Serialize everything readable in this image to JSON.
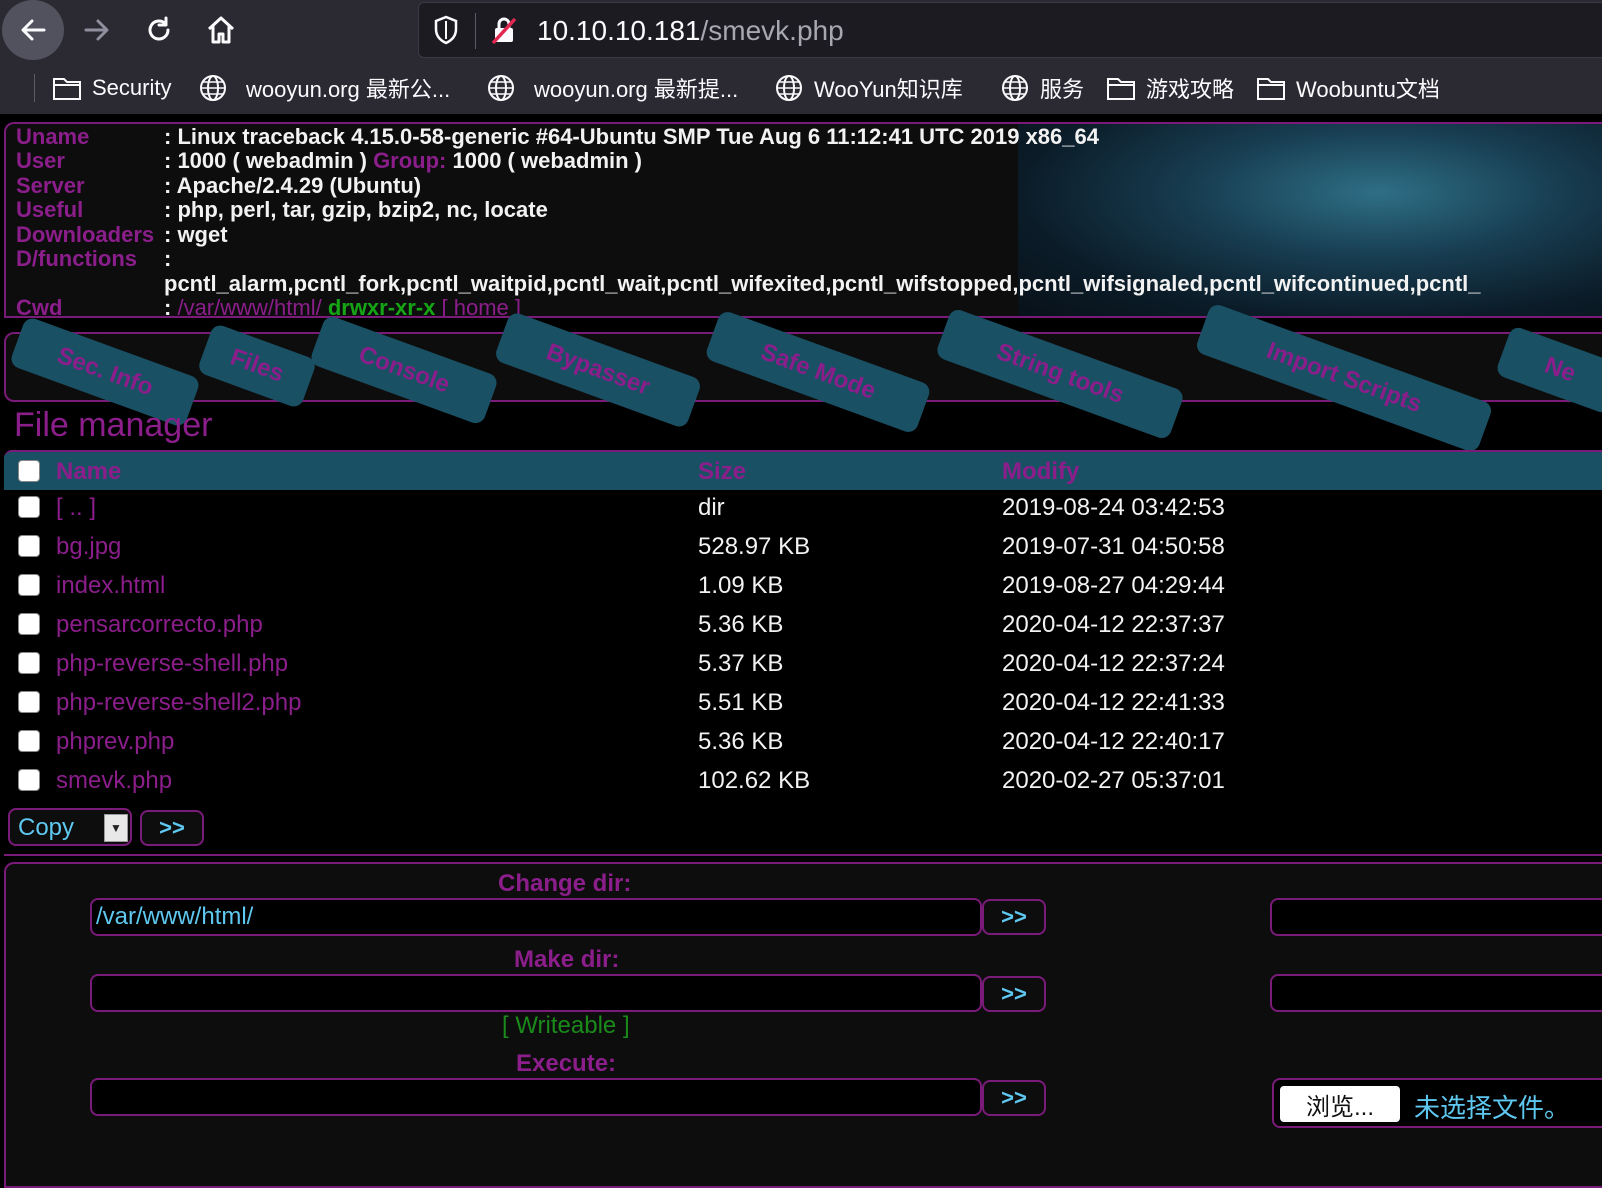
{
  "browser": {
    "url_host": "10.10.10.181",
    "url_path": "/smevk.php",
    "bookmarks": [
      {
        "label": "Security",
        "icon": "folder-icon"
      },
      {
        "label": "wooyun.org 最新公...",
        "icon": "globe-icon"
      },
      {
        "label": "wooyun.org 最新提...",
        "icon": "globe-icon"
      },
      {
        "label": "WooYun知识库",
        "icon": "globe-icon"
      },
      {
        "label": "服务",
        "icon": "globe-icon"
      },
      {
        "label": "游戏攻略",
        "icon": "folder-icon"
      },
      {
        "label": "Woobuntu文档",
        "icon": "folder-icon"
      }
    ]
  },
  "info": {
    "uname_label": "Uname",
    "uname_value": ": Linux traceback 4.15.0-58-generic #64-Ubuntu SMP Tue Aug 6 11:12:41 UTC 2019 x86_64",
    "user_label": "User",
    "user_value": ": 1000 ( webadmin ) ",
    "group_label": "Group:",
    "group_value": " 1000 ( webadmin )",
    "server_label": "Server",
    "server_value": ": Apache/2.4.29 (Ubuntu)",
    "useful_label": "Useful",
    "useful_value": ": php, perl, tar, gzip, bzip2, nc, locate",
    "downloaders_label": "Downloaders",
    "downloaders_value": ": wget",
    "dfunctions_label": "D/functions",
    "dfunctions_colon": ":",
    "dfunctions_value": "pcntl_alarm,pcntl_fork,pcntl_waitpid,pcntl_wait,pcntl_wifexited,pcntl_wifstopped,pcntl_wifsignaled,pcntl_wifcontinued,pcntl_",
    "cwd_label": "Cwd",
    "cwd_colon": ": ",
    "cwd_path": "/var/www/html/",
    "cwd_perms": " drwxr-xr-x",
    "cwd_home": " [ home ]"
  },
  "menu": {
    "tabs": [
      "Sec. Info",
      "Files",
      "Console",
      "Bypasser",
      "Safe Mode",
      "String tools",
      "Import Scripts",
      "Ne"
    ]
  },
  "file_manager": {
    "title": "File manager",
    "columns": {
      "name": "Name",
      "size": "Size",
      "modify": "Modify"
    },
    "rows": [
      {
        "name": "[ .. ]",
        "size": "dir",
        "modify": "2019-08-24 03:42:53"
      },
      {
        "name": "bg.jpg",
        "size": "528.97 KB",
        "modify": "2019-07-31 04:50:58"
      },
      {
        "name": "index.html",
        "size": "1.09 KB",
        "modify": "2019-08-27 04:29:44"
      },
      {
        "name": "pensarcorrecto.php",
        "size": "5.36 KB",
        "modify": "2020-04-12 22:37:37"
      },
      {
        "name": "php-reverse-shell.php",
        "size": "5.37 KB",
        "modify": "2020-04-12 22:37:24"
      },
      {
        "name": "php-reverse-shell2.php",
        "size": "5.51 KB",
        "modify": "2020-04-12 22:41:33"
      },
      {
        "name": "phprev.php",
        "size": "5.36 KB",
        "modify": "2020-04-12 22:40:17"
      },
      {
        "name": "smevk.php",
        "size": "102.62 KB",
        "modify": "2020-02-27 05:37:01"
      }
    ],
    "action_select": "Copy",
    "go_label": ">>"
  },
  "tools": {
    "change_dir_label": "Change dir:",
    "change_dir_value": "/var/www/html/",
    "make_dir_label": "Make dir:",
    "make_dir_value": "",
    "writeable": "[ Writeable ]",
    "execute_label": "Execute:",
    "execute_value": "",
    "go_label": ">>",
    "browse_label": "浏览...",
    "no_file_label": "未选择文件。"
  },
  "colors": {
    "accent_purple": "#8b1e8b",
    "teal": "#1a5064",
    "cyan_text": "#5fc8f0",
    "green": "#15a515"
  }
}
